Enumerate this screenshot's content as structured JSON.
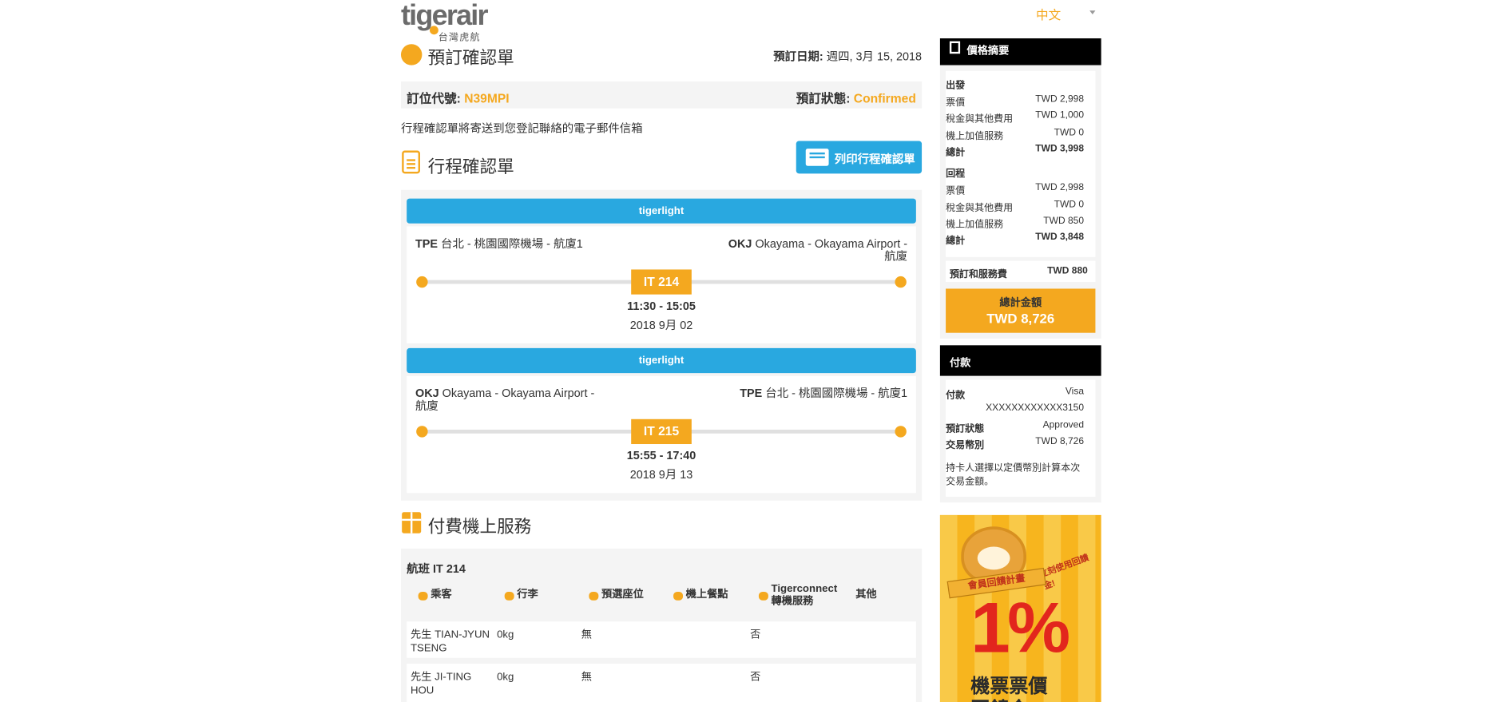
{
  "header": {
    "logo_text": "tigerair",
    "logo_sub": "台灣虎航",
    "language": "中文"
  },
  "confirmation": {
    "title": "預訂確認單",
    "date_label": "預訂日期:",
    "date_value": "週四, 3月 15, 2018",
    "pnr_label": "訂位代號:",
    "pnr_value": "N39MPI",
    "status_label": "預訂狀態:",
    "status_value": "Confirmed",
    "email_note": "行程確認單將寄送到您登記聯絡的電子郵件信箱"
  },
  "itinerary": {
    "title": "行程確認單",
    "print_label": "列印行程確認單",
    "flights": [
      {
        "fare": "tigerlight",
        "dep_code": "TPE",
        "dep_name": "台北 - 桃園國際機場 - 航廈1",
        "arr_code": "OKJ",
        "arr_name": "Okayama - Okayama Airport - 航廈",
        "flight_no": "IT 214",
        "time": "11:30 - 15:05",
        "date": "2018 9月 02"
      },
      {
        "fare": "tigerlight",
        "dep_code": "OKJ",
        "dep_name": "Okayama - Okayama Airport - 航廈",
        "arr_code": "TPE",
        "arr_name": "台北 - 桃園國際機場 - 航廈1",
        "flight_no": "IT 215",
        "time": "15:55 - 17:40",
        "date": "2018 9月 13"
      }
    ]
  },
  "services": {
    "title": "付費機上服務",
    "flight_label": "航班 IT 214",
    "columns": {
      "passenger": "乘客",
      "baggage": "行李",
      "seat": "預選座位",
      "meal": "機上餐點",
      "connect_1": "Tigerconnect",
      "connect_2": "轉機服務",
      "other": "其他"
    },
    "rows": [
      {
        "title": "先生",
        "name": "TIAN-JYUN TSENG",
        "baggage": "0kg",
        "seat": "無",
        "connect": "否"
      },
      {
        "title": "先生",
        "name": "JI-TING HOU",
        "baggage": "0kg",
        "seat": "無",
        "connect": "否"
      }
    ]
  },
  "price_summary": {
    "title": "價格摘要",
    "outbound": {
      "label": "出發",
      "fare": [
        "票價",
        "TWD 2,998"
      ],
      "tax": [
        "稅金與其他費用",
        "TWD 1,000"
      ],
      "addons": [
        "機上加值服務",
        "TWD 0"
      ],
      "total": [
        "總計",
        "TWD 3,998"
      ]
    },
    "return": {
      "label": "回程",
      "fare": [
        "票價",
        "TWD 2,998"
      ],
      "tax": [
        "稅金與其他費用",
        "TWD 0"
      ],
      "addons": [
        "機上加值服務",
        "TWD 850"
      ],
      "total": [
        "總計",
        "TWD 3,848"
      ]
    },
    "service_fee": [
      "預訂和服務費",
      "TWD 880"
    ],
    "grand_total_label": "總計金額",
    "grand_total_value": "TWD 8,726"
  },
  "payment": {
    "title": "付款",
    "method": [
      "付款",
      "Visa"
    ],
    "card": "XXXXXXXXXXXX3150",
    "status": [
      "預訂狀態",
      "Approved"
    ],
    "currency": [
      "交易幣別",
      "TWD 8,726"
    ],
    "note": "持卡人選擇以定價幣別計算本次交易金額。"
  },
  "promo": {
    "ribbon": "會員回饋計畫",
    "tag": "立刻使用回饋金!",
    "percent": "1%",
    "line1": "機票票價",
    "line2": "回饋金"
  }
}
